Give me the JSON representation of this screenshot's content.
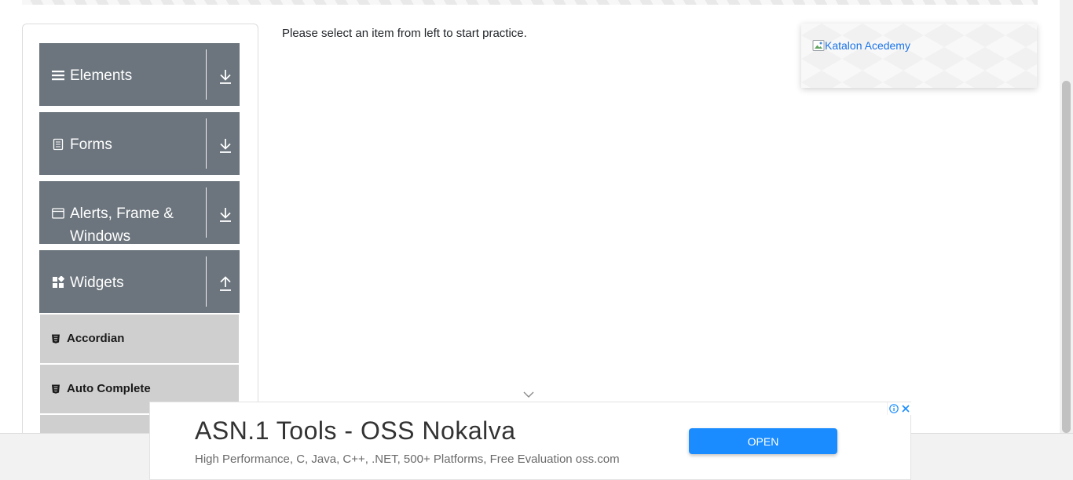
{
  "sidebar": {
    "groups": [
      {
        "label": "Elements",
        "icon": "hamburger-icon",
        "arrow": "download-arrow-icon"
      },
      {
        "label": "Forms",
        "icon": "document-icon",
        "arrow": "download-arrow-icon"
      },
      {
        "label": "Alerts, Frame & Windows",
        "icon": "window-icon",
        "arrow": "download-arrow-icon"
      },
      {
        "label": "Widgets",
        "icon": "widgets-grid-icon",
        "arrow": "upload-arrow-icon"
      }
    ],
    "widget_items": [
      {
        "label": "Accordian",
        "icon": "html5-icon"
      },
      {
        "label": "Auto Complete",
        "icon": "html5-icon"
      }
    ]
  },
  "main": {
    "intro_text": "Please select an item from left to start practice."
  },
  "side_ad": {
    "image_alt": "Katalon Acedemy"
  },
  "bottom_ad": {
    "title": "ASN.1 Tools - OSS Nokalva",
    "description": "High Performance, C, Java, C++, .NET, 500+ Platforms, Free Evaluation oss.com",
    "button_label": "OPEN"
  },
  "colors": {
    "group_header_bg": "#6c757d",
    "sub_item_bg": "#cfcfcf",
    "ad_button": "#1a8cff",
    "link": "#1a73e8"
  }
}
